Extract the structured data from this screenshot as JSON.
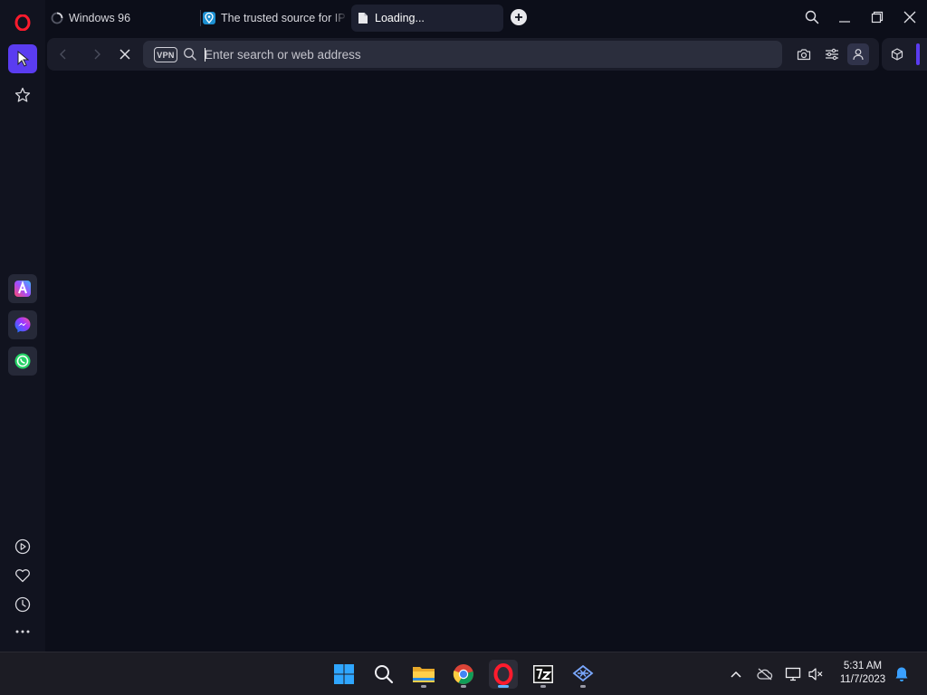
{
  "browser": {
    "tabs": [
      {
        "title": "Windows 96",
        "icon": "loading-spinner-icon",
        "active": false
      },
      {
        "title": "The trusted source for IP a",
        "icon": "ipinfo-pin-icon",
        "active": false
      },
      {
        "title": "Loading...",
        "icon": "page-icon",
        "active": true
      }
    ],
    "address_bar": {
      "vpn_label": "VPN",
      "placeholder": "Enter search or web address",
      "value": ""
    }
  },
  "colors": {
    "accent": "#5a3cf0",
    "page_background": "#0c0e19",
    "opera_red": "#ff1b2d"
  },
  "sidebar": {
    "top_items": [
      "opera-logo-icon",
      "aria-cursor-icon",
      "star-icon"
    ],
    "apps": [
      "aria-icon",
      "messenger-icon",
      "whatsapp-icon"
    ],
    "bottom_items": [
      "player-icon",
      "heart-icon",
      "history-clock-icon",
      "more-dots-icon"
    ]
  },
  "taskbar": {
    "apps": [
      "windows-start-icon",
      "search-icon",
      "file-explorer-icon",
      "chrome-icon",
      "opera-icon",
      "7zip-icon",
      "network-app-icon"
    ],
    "time": "5:31 AM",
    "date": "11/7/2023"
  }
}
